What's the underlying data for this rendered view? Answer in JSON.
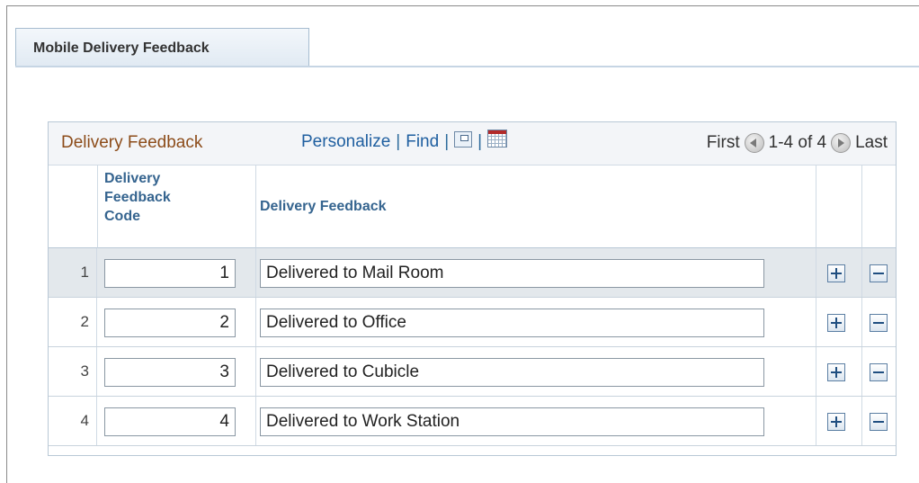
{
  "tab": {
    "label": "Mobile Delivery Feedback"
  },
  "grid": {
    "title": "Delivery Feedback",
    "toolbar": {
      "personalize": "Personalize",
      "separator": "|",
      "find": "Find",
      "zoom_icon": "zoom-icon",
      "download_icon": "download-spreadsheet-icon"
    },
    "pager": {
      "first": "First",
      "range": "1-4 of 4",
      "last": "Last"
    },
    "columns": {
      "code": "Delivery Feedback Code",
      "code_line1": "Delivery",
      "code_line2": "Feedback",
      "code_line3": "Code",
      "description": "Delivery Feedback"
    },
    "rows": [
      {
        "num": "1",
        "code": "1",
        "description": "Delivered to Mail Room"
      },
      {
        "num": "2",
        "code": "2",
        "description": "Delivered to Office"
      },
      {
        "num": "3",
        "code": "3",
        "description": "Delivered to Cubicle"
      },
      {
        "num": "4",
        "code": "4",
        "description": "Delivered to Work Station"
      }
    ]
  },
  "colors": {
    "title": "#8c4c1a",
    "link": "#1f5fa0",
    "column_header": "#35648f",
    "highlight_row": "#e3e8ec"
  }
}
